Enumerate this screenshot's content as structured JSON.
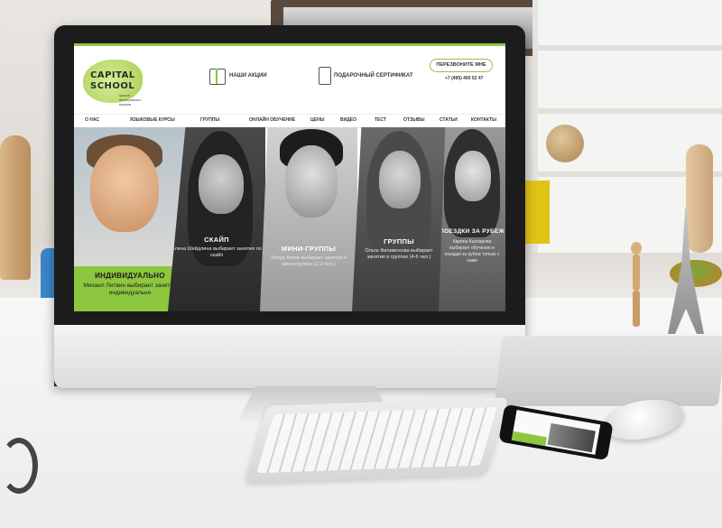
{
  "site": {
    "logo": {
      "line1": "CAPITAL",
      "line2": "SCHOOL",
      "tagline": "школа иностранных языков"
    },
    "header": {
      "promo_label": "НАШИ АКЦИИ",
      "certificate_label": "ПОДАРОЧНЫЙ СЕРТИФИКАТ",
      "callback_button": "ПЕРЕЗВОНИТЕ МНЕ",
      "phone": "+7 (495) 400 52 47"
    },
    "nav": [
      "О НАС",
      "ЯЗЫКОВЫЕ КУРСЫ",
      "ГРУППЫ",
      "ОНЛАЙН ОБУЧЕНИЕ",
      "ЦЕНЫ",
      "ВИДЕО",
      "ТЕСТ",
      "ОТЗЫВЫ",
      "СТАТЬИ",
      "КОНТАКТЫ"
    ],
    "panels": [
      {
        "title": "ИНДИВИДУАЛЬНО",
        "desc": "Михаил Литвин выбирает занятия индивидуально"
      },
      {
        "title": "СКАЙП",
        "desc": "Елена Шейдлина выбирает занятия по скайп"
      },
      {
        "title": "МИНИ-ГРУППЫ",
        "desc": "Тимур Агеев выбирает занятия в мини-группах (2-3 чел.)"
      },
      {
        "title": "ГРУППЫ",
        "desc": "Ольга Филимонова выбирает занятия в группах (4-6 чел.)"
      },
      {
        "title": "ПОЕЗДКИ ЗА РУБЕЖ",
        "desc": "Карина Каспарова выбирает обучение и поездки за рубеж только с нами"
      }
    ]
  },
  "colors": {
    "accent": "#8dc63f",
    "monitor_bezel": "#1c1c1c"
  }
}
